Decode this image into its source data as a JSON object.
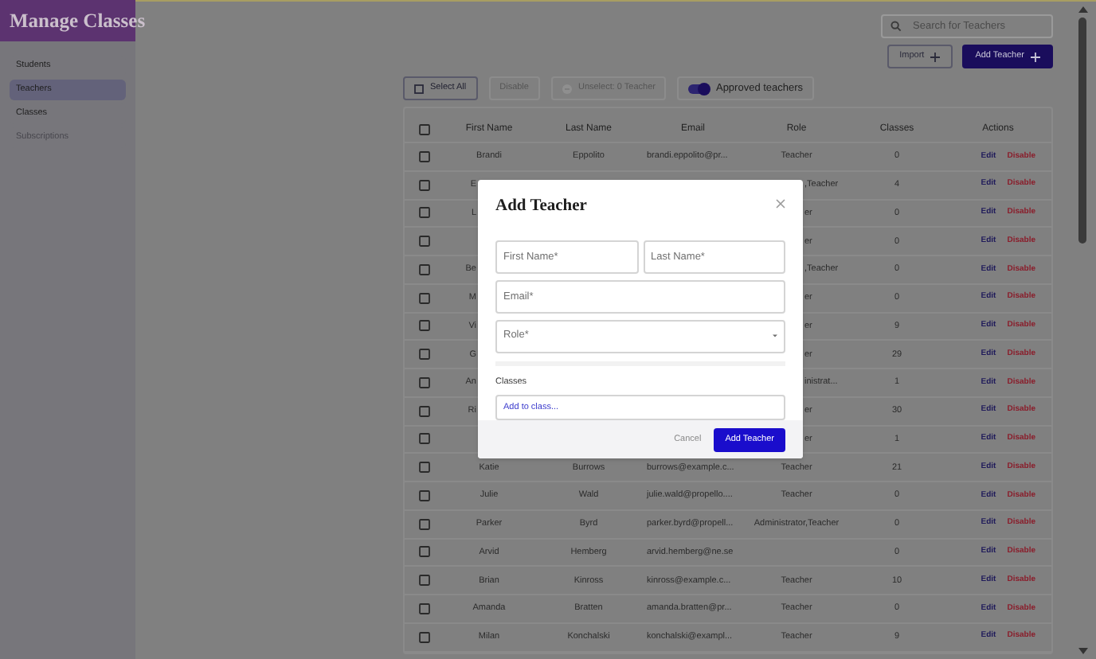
{
  "app_title": "Manage Classes",
  "sidebar": {
    "items": [
      {
        "label": "Students",
        "selected": false,
        "disabled": false
      },
      {
        "label": "Teachers",
        "selected": true,
        "disabled": false
      },
      {
        "label": "Classes",
        "selected": false,
        "disabled": false
      },
      {
        "label": "Subscriptions",
        "selected": false,
        "disabled": true
      }
    ]
  },
  "search": {
    "placeholder": "Search for Teachers"
  },
  "header_buttons": [
    {
      "label": "Import",
      "kind": "outline"
    },
    {
      "label": "Add Teacher",
      "kind": "primary"
    }
  ],
  "toolbar": {
    "select_all": {
      "label": "Select All",
      "disabled": false
    },
    "disable": {
      "label": "Disable",
      "disabled": true
    },
    "unselect": {
      "label": "Unselect: 0 Teacher",
      "disabled": true
    },
    "toggle": {
      "label": "Approved teachers",
      "on": true
    }
  },
  "table": {
    "header_checked": false,
    "columns": [
      "First Name",
      "Last Name",
      "Email",
      "Role",
      "Classes",
      "Actions"
    ],
    "rows": [
      {
        "kind": "full",
        "checked": false,
        "first_name": "Brandi",
        "last_name": "Eppolito",
        "email": "brandi.eppolito@pr...",
        "role": "Teacher",
        "classes": "0",
        "actions": [
          "Edit",
          "Disable"
        ]
      },
      {
        "kind": "covered",
        "checked": false,
        "first_name": "E",
        "role": ",Teacher",
        "classes": "4",
        "actions": [
          "Edit",
          "Disable"
        ]
      },
      {
        "kind": "covered",
        "checked": false,
        "first_name": "L",
        "role": "er",
        "classes": "0",
        "actions": [
          "Edit",
          "Disable"
        ]
      },
      {
        "kind": "covered",
        "checked": false,
        "role": "er",
        "classes": "0",
        "actions": [
          "Edit",
          "Disable"
        ]
      },
      {
        "kind": "covered",
        "checked": false,
        "first_name": "Be",
        "role": ",Teacher",
        "classes": "0",
        "actions": [
          "Edit",
          "Disable"
        ]
      },
      {
        "kind": "covered",
        "checked": false,
        "first_name": "M",
        "role": "er",
        "classes": "0",
        "actions": [
          "Edit",
          "Disable"
        ]
      },
      {
        "kind": "covered",
        "checked": false,
        "first_name": "Vi",
        "role": "er",
        "classes": "9",
        "actions": [
          "Edit",
          "Disable"
        ]
      },
      {
        "kind": "covered",
        "checked": false,
        "first_name": "G",
        "role": "er",
        "classes": "29",
        "actions": [
          "Edit",
          "Disable"
        ]
      },
      {
        "kind": "covered",
        "checked": false,
        "first_name": "An",
        "role": "inistrat...",
        "classes": "1",
        "actions": [
          "Edit",
          "Disable"
        ]
      },
      {
        "kind": "covered",
        "checked": false,
        "first_name": "Ri",
        "role": "er",
        "classes": "30",
        "actions": [
          "Edit",
          "Disable"
        ]
      },
      {
        "kind": "covered",
        "checked": false,
        "role": "er",
        "classes": "1",
        "actions": [
          "Edit",
          "Disable"
        ]
      },
      {
        "kind": "full",
        "checked": false,
        "first_name": "Katie",
        "last_name": "Burrows",
        "email": "burrows@example.c...",
        "role": "Teacher",
        "classes": "21",
        "actions": [
          "Edit",
          "Disable"
        ]
      },
      {
        "kind": "full",
        "checked": false,
        "first_name": "Julie",
        "last_name": "Wald",
        "email": "julie.wald@propello....",
        "role": "Teacher",
        "classes": "0",
        "actions": [
          "Edit",
          "Disable"
        ]
      },
      {
        "kind": "full",
        "checked": false,
        "first_name": "Parker",
        "last_name": "Byrd",
        "email": "parker.byrd@propell...",
        "role": "Administrator,Teacher",
        "classes": "0",
        "actions": [
          "Edit",
          "Disable"
        ]
      },
      {
        "kind": "full",
        "checked": false,
        "first_name": "Arvid",
        "last_name": "Hemberg",
        "email": "arvid.hemberg@ne.se",
        "classes": "0",
        "actions": [
          "Edit",
          "Disable"
        ]
      },
      {
        "kind": "full",
        "checked": false,
        "first_name": "Brian",
        "last_name": "Kinross",
        "email": "kinross@example.c...",
        "role": "Teacher",
        "classes": "10",
        "actions": [
          "Edit",
          "Disable"
        ]
      },
      {
        "kind": "full",
        "checked": false,
        "first_name": "Amanda",
        "last_name": "Bratten",
        "email": "amanda.bratten@pr...",
        "role": "Teacher",
        "classes": "0",
        "actions": [
          "Edit",
          "Disable"
        ]
      },
      {
        "kind": "full",
        "checked": false,
        "first_name": "Milan",
        "last_name": "Konchalski",
        "email": "konchalski@exampl...",
        "role": "Teacher",
        "classes": "9",
        "actions": [
          "Edit",
          "Disable"
        ]
      }
    ]
  },
  "modal": {
    "title": "Add Teacher",
    "fields": [
      {
        "kind": "text",
        "placeholder": "First Name*"
      },
      {
        "kind": "text",
        "placeholder": "Last Name*"
      },
      {
        "kind": "text",
        "placeholder": "Email*"
      },
      {
        "kind": "select",
        "placeholder": "Role*"
      }
    ],
    "classes_label": "Classes",
    "classes_placeholder": "Add to class...",
    "buttons": [
      {
        "label": "Cancel",
        "kind": "text"
      },
      {
        "label": "Add Teacher",
        "kind": "primary"
      }
    ]
  }
}
